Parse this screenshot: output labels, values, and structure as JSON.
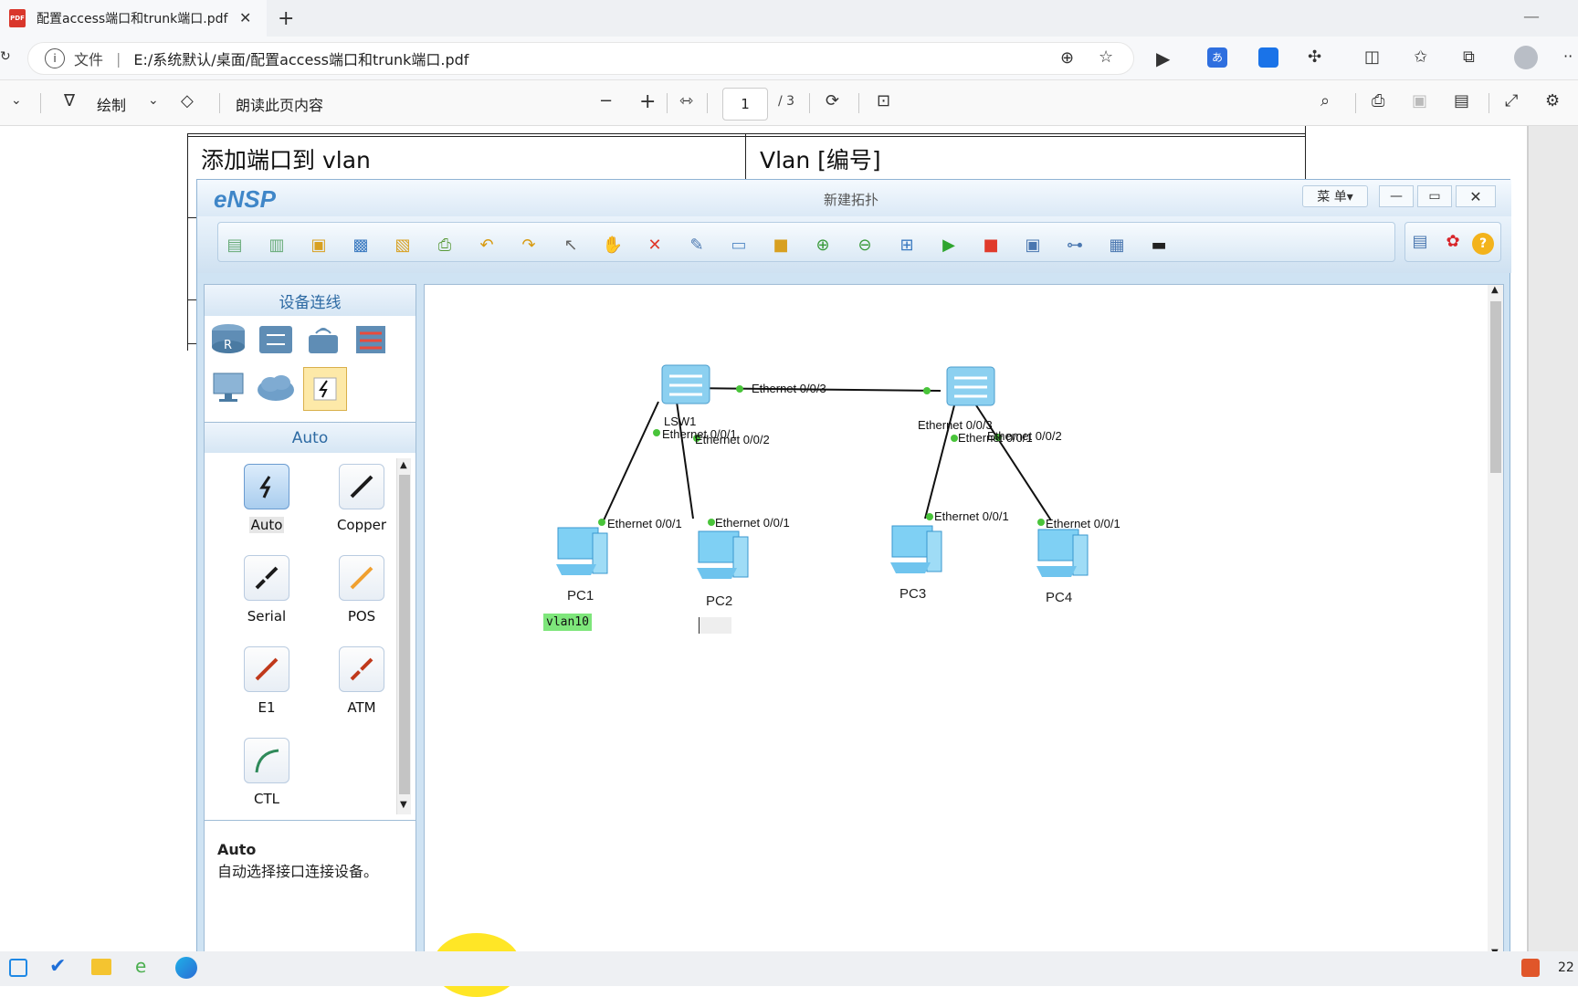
{
  "browser": {
    "tab_title": "配置access端口和trunk端口.pdf",
    "pdf_badge": "PDF",
    "address_prefix": "文件",
    "address_url": "E:/系统默认/桌面/配置access端口和trunk端口.pdf"
  },
  "pdf_toolbar": {
    "draw_label": "绘制",
    "read_aloud_label": "朗读此页内容",
    "page_current": "1",
    "page_total": "/ 3"
  },
  "document": {
    "row_left": "添加端口到 vlan",
    "row_right": "Vlan [编号]"
  },
  "ensp": {
    "logo": "eNSP",
    "window_title": "新建拓扑",
    "menu_label": "菜 单▾",
    "panel_title": "设备连线",
    "category_title": "Auto",
    "cables": [
      {
        "label": "Auto",
        "color": "#1b1b1b"
      },
      {
        "label": "Copper",
        "color": "#1b1b1b"
      },
      {
        "label": "Serial",
        "color": "#1b1b1b"
      },
      {
        "label": "POS",
        "color": "#f0a030"
      },
      {
        "label": "E1",
        "color": "#c0391b"
      },
      {
        "label": "ATM",
        "color": "#c0391b"
      },
      {
        "label": "CTL",
        "color": "#2f8a5a"
      }
    ],
    "info_title": "Auto",
    "info_text": "自动选择接口连接设备。",
    "topology": {
      "lsw1": "LSW1",
      "lsw2_overlap": "Ethernet 0/0/3",
      "link_lsw": "Ethernet 0/0/3",
      "lsw1_p1": "Ethernet 0/0/1",
      "lsw1_p2": "Ethernet 0/0/2",
      "lsw2_p1": "Ethernet 0/0/1",
      "lsw2_p2": "Ethernet 0/0/2",
      "pc1_port": "Ethernet 0/0/1",
      "pc2_port": "Ethernet 0/0/1",
      "pc3_port": "Ethernet 0/0/1",
      "pc4_port": "Ethernet 0/0/1",
      "pc1": "PC1",
      "pc2": "PC2",
      "pc3": "PC3",
      "pc4": "PC4",
      "note_vlan": "vlan10"
    }
  },
  "taskbar": {
    "clock_partial": "22"
  }
}
